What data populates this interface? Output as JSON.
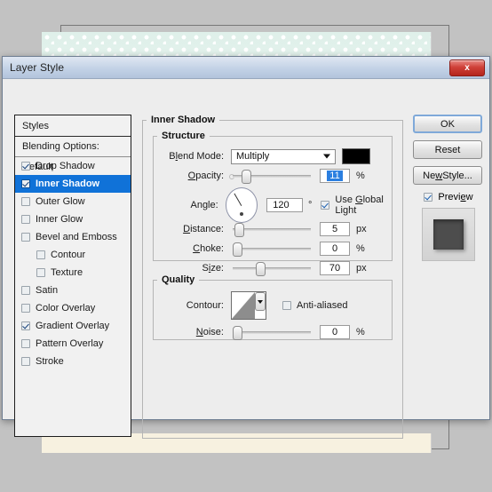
{
  "window": {
    "title": "Layer Style",
    "close_label": "x"
  },
  "styles_list": {
    "header": "Styles",
    "blending_options": "Blending Options: Default",
    "items": [
      {
        "label": "Drop Shadow",
        "checked": true,
        "indent": false,
        "selected": false
      },
      {
        "label": "Inner Shadow",
        "checked": true,
        "indent": false,
        "selected": true
      },
      {
        "label": "Outer Glow",
        "checked": false,
        "indent": false,
        "selected": false
      },
      {
        "label": "Inner Glow",
        "checked": false,
        "indent": false,
        "selected": false
      },
      {
        "label": "Bevel and Emboss",
        "checked": false,
        "indent": false,
        "selected": false
      },
      {
        "label": "Contour",
        "checked": false,
        "indent": true,
        "selected": false
      },
      {
        "label": "Texture",
        "checked": false,
        "indent": true,
        "selected": false
      },
      {
        "label": "Satin",
        "checked": false,
        "indent": false,
        "selected": false
      },
      {
        "label": "Color Overlay",
        "checked": false,
        "indent": false,
        "selected": false
      },
      {
        "label": "Gradient Overlay",
        "checked": true,
        "indent": false,
        "selected": false
      },
      {
        "label": "Pattern Overlay",
        "checked": false,
        "indent": false,
        "selected": false
      },
      {
        "label": "Stroke",
        "checked": false,
        "indent": false,
        "selected": false
      }
    ]
  },
  "panel": {
    "title": "Inner Shadow",
    "structure": {
      "title": "Structure",
      "blend_mode_label": "Blend Mode:",
      "blend_mode_value": "Multiply",
      "blend_color": "#000000",
      "opacity_label": "Opacity:",
      "opacity_value": "11",
      "opacity_unit": "%",
      "angle_label": "Angle:",
      "angle_value": "120",
      "angle_unit": "°",
      "use_global_light_label": "Use Global Light",
      "use_global_light_checked": true,
      "distance_label": "Distance:",
      "distance_value": "5",
      "distance_unit": "px",
      "choke_label": "Choke:",
      "choke_value": "0",
      "choke_unit": "%",
      "size_label": "Size:",
      "size_value": "70",
      "size_unit": "px"
    },
    "quality": {
      "title": "Quality",
      "contour_label": "Contour:",
      "anti_aliased_label": "Anti-aliased",
      "anti_aliased_checked": false,
      "noise_label": "Noise:",
      "noise_value": "0",
      "noise_unit": "%"
    }
  },
  "buttons": {
    "ok": "OK",
    "reset": "Reset",
    "new_style": "New Style...",
    "preview_label": "Preview",
    "preview_checked": true
  },
  "colors": {
    "selection": "#1072d8",
    "title_bar": "#c3d2e6",
    "close": "#cf4038",
    "dialog_bg": "#ededed",
    "canvas_band_top": "#dff0ea",
    "canvas_band_bottom": "#f7f1e0"
  }
}
